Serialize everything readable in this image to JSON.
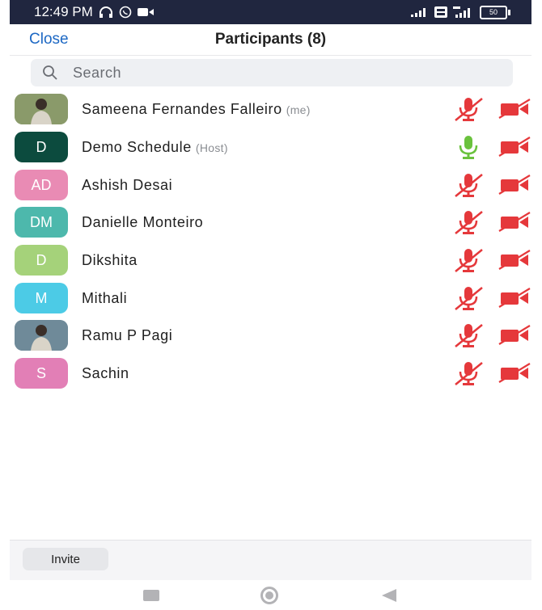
{
  "status_bar": {
    "time": "12:49 PM",
    "battery": "50",
    "icons": [
      "headphones-icon",
      "whatsapp-icon",
      "video-icon",
      "signal-icon",
      "volte-icon",
      "4g-signal-icon",
      "battery-icon"
    ]
  },
  "header": {
    "close_label": "Close",
    "title": "Participants (8)"
  },
  "search": {
    "placeholder": "Search",
    "value": ""
  },
  "participants": [
    {
      "name": "Sameena Fernandes Falleiro",
      "tag": "(me)",
      "initials": "",
      "avatar_type": "photo",
      "avatar_color": "#8a9a6a",
      "mic": "muted",
      "camera": "off"
    },
    {
      "name": "Demo Schedule",
      "tag": "(Host)",
      "initials": "D",
      "avatar_type": "initials",
      "avatar_color": "#0c4b3e",
      "mic": "on",
      "camera": "off"
    },
    {
      "name": "Ashish Desai",
      "tag": "",
      "initials": "AD",
      "avatar_type": "initials",
      "avatar_color": "#e98bb4",
      "mic": "muted",
      "camera": "off"
    },
    {
      "name": "Danielle Monteiro",
      "tag": "",
      "initials": "DM",
      "avatar_type": "initials",
      "avatar_color": "#4db8ac",
      "mic": "muted",
      "camera": "off"
    },
    {
      "name": "Dikshita",
      "tag": "",
      "initials": "D",
      "avatar_type": "initials",
      "avatar_color": "#a5d27a",
      "mic": "muted",
      "camera": "off"
    },
    {
      "name": "Mithali",
      "tag": "",
      "initials": "M",
      "avatar_type": "initials",
      "avatar_color": "#4ccbe6",
      "mic": "muted",
      "camera": "off"
    },
    {
      "name": "Ramu P Pagi",
      "tag": "",
      "initials": "",
      "avatar_type": "photo",
      "avatar_color": "#6f8a99",
      "mic": "muted",
      "camera": "off"
    },
    {
      "name": "Sachin",
      "tag": "",
      "initials": "S",
      "avatar_type": "initials",
      "avatar_color": "#e27fb6",
      "mic": "muted",
      "camera": "off"
    }
  ],
  "footer": {
    "invite_label": "Invite"
  },
  "colors": {
    "accent": "#1d68c4",
    "muted_red": "#e5383b",
    "mic_on_green": "#6ac23d",
    "status_bar": "#20263f"
  }
}
